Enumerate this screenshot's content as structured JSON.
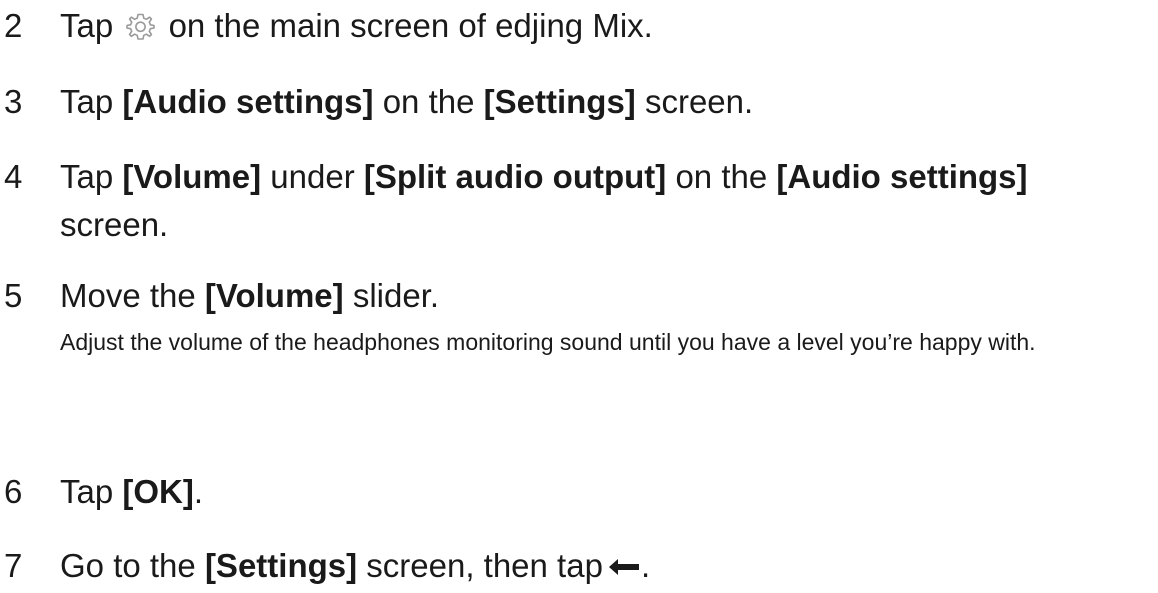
{
  "steps": [
    {
      "num": "2",
      "pre": "Tap",
      "icon": "gear-icon",
      "post": "on the main screen of edjing Mix."
    },
    {
      "num": "3",
      "t1": "Tap ",
      "b1": "[Audio settings]",
      "t2": " on the ",
      "b2": "[Settings]",
      "t3": " screen."
    },
    {
      "num": "4",
      "t1": "Tap ",
      "b1": "[Volume]",
      "t2": " under ",
      "b2": "[Split audio output]",
      "t3": " on the ",
      "b3": "[Audio settings]",
      "t4": " screen."
    },
    {
      "num": "5",
      "t1": "Move the ",
      "b1": "[Volume]",
      "t2": " slider.",
      "note": "Adjust the volume of the headphones monitoring sound until you have a level you’re happy with."
    },
    {
      "num": "6",
      "t1": "Tap ",
      "b1": "[OK]",
      "t2": "."
    },
    {
      "num": "7",
      "t1": "Go to the ",
      "b1": "[Settings]",
      "t2": " screen, then tap",
      "icon": "back-arrow-icon",
      "t3": "."
    }
  ]
}
